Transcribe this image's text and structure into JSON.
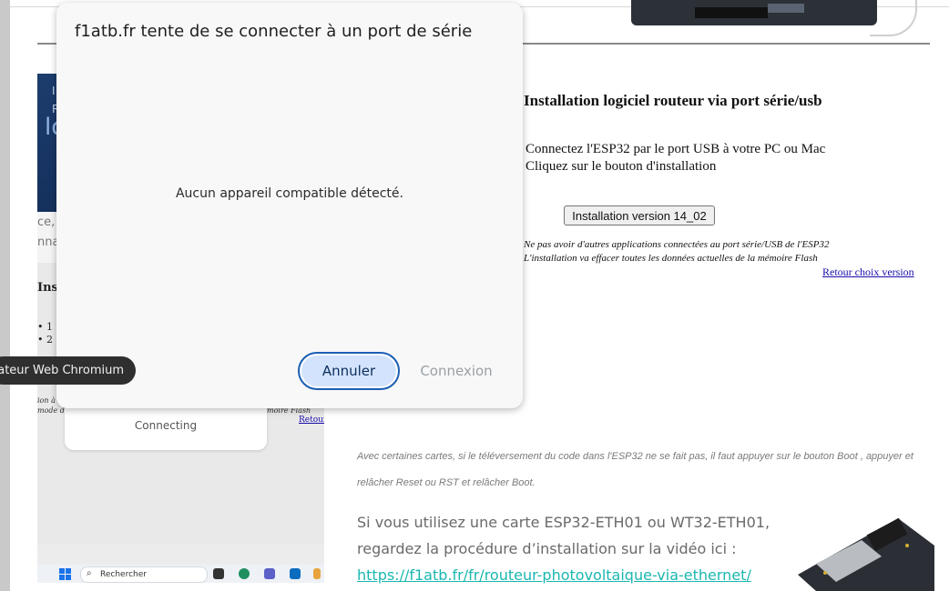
{
  "dialog": {
    "title": "f1atb.fr tente de se connecter à un port de série",
    "message": "Aucun appareil compatible détecté.",
    "cancel_label": "Annuler",
    "connect_label": "Connexion"
  },
  "tooltip": {
    "text": "Navigateur Web Chromium"
  },
  "page": {
    "title": "Installation logiciel routeur via port série/usb",
    "instruction_1": "Connectez l'ESP32 par le port USB à votre PC ou Mac",
    "instruction_2": "Cliquez sur le bouton d'installation",
    "install_button": "Installation version 14_02",
    "warning_1": "Ne pas avoir d'autres applications connectées au port série/USB de l'ESP32",
    "warning_2": "L'installation va effacer toutes les données actuelles de la mémoire Flash",
    "retour_link": "Retour choix version",
    "boot_note_1": "Avec certaines cartes, si le téléversement du code dans l'ESP32 ne se fait pas, il faut appuyer sur le bouton Boot , appuyer et",
    "boot_note_2": "relâcher Reset ou RST et relâcher Boot.",
    "eth_line_1": "Si vous utilisez une carte ESP32-ETH01 ou WT32-ETH01,",
    "eth_line_2": "regardez la procédure d’installation sur la vidéo ici :",
    "eth_link": "https://f1atb.fr/fr/routeur-photovoltaique-via-ethernet/"
  },
  "screenshot": {
    "hero_small_1": "I",
    "hero_small_2": "R",
    "hero_large": "lo",
    "strip_1": "ce, l",
    "strip_2": "nna",
    "section_heading": "Ins",
    "list_1": "• 1",
    "list_2": "• 2",
    "small_left_1": "ion à",
    "small_left_2": "mode d'i",
    "small_right": "moire Flash",
    "retour": "Retour",
    "card_status": "Connecting",
    "taskbar_search": "Rechercher"
  },
  "icons": {
    "search": "magnifier-icon",
    "windows": "windows-start-icon"
  },
  "colors": {
    "dialog_bg": "#f8f8f8",
    "cancel_bg": "#d3e3fd",
    "cancel_border": "#1a5fb4",
    "link_teal": "#1ab7b0",
    "link_blue": "#1a0dab",
    "tooltip_bg": "#2f2f2f"
  }
}
